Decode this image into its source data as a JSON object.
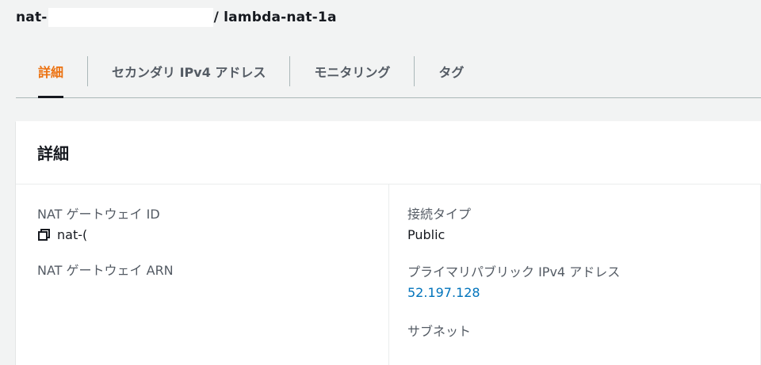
{
  "title": {
    "prefix": "nat-",
    "suffix": "/ lambda-nat-1a"
  },
  "tabs": [
    {
      "label": "詳細",
      "active": true
    },
    {
      "label": "セカンダリ IPv4 アドレス",
      "active": false
    },
    {
      "label": "モニタリング",
      "active": false
    },
    {
      "label": "タグ",
      "active": false
    }
  ],
  "panel": {
    "title": "詳細",
    "left": {
      "nat_id_label": "NAT ゲートウェイ ID",
      "nat_id_value": "nat-(",
      "nat_arn_label": "NAT ゲートウェイ ARN"
    },
    "right": {
      "conn_type_label": "接続タイプ",
      "conn_type_value": "Public",
      "primary_ip_label": "プライマリパブリック IPv4 アドレス",
      "primary_ip_value": "52.197.128",
      "subnet_label": "サブネット"
    }
  },
  "colors": {
    "accent_active_tab": "#ec7211",
    "link": "#0073bb",
    "text": "#16191f",
    "muted": "#545b64"
  },
  "icons": {
    "copy": "copy-icon"
  }
}
